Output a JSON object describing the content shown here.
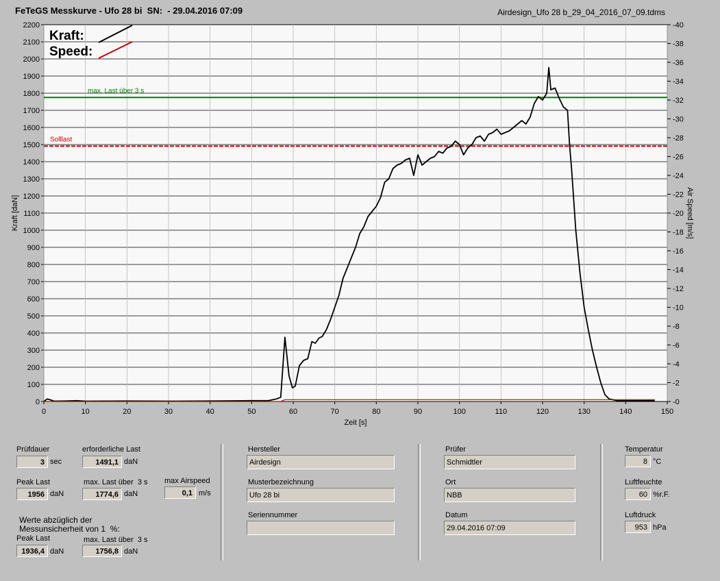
{
  "header": {
    "title": "FeTeGS Messkurve - Ufo 28 bi  SN:  - 29.04.2016 07:09",
    "filename": "Airdesign_Ufo 28 b_29_04_2016_07_09.tdms"
  },
  "chart_data": {
    "type": "line",
    "xlabel": "Zeit [s]",
    "ylabel": "Kraft [daN]",
    "y2label": "Air Speed [m/s]",
    "xlim": [
      0,
      150
    ],
    "ylim": [
      0,
      2200
    ],
    "y2lim": [
      0,
      40
    ],
    "x_ticks": [
      0,
      10,
      20,
      30,
      40,
      50,
      60,
      70,
      80,
      90,
      100,
      110,
      120,
      130,
      140,
      150
    ],
    "y_ticks": [
      0,
      100,
      200,
      300,
      400,
      500,
      600,
      700,
      800,
      900,
      1000,
      1100,
      1200,
      1300,
      1400,
      1500,
      1600,
      1700,
      1800,
      1900,
      2000,
      2100,
      2200
    ],
    "y2_ticks": [
      0,
      2,
      4,
      6,
      8,
      10,
      12,
      14,
      16,
      18,
      20,
      22,
      24,
      26,
      28,
      30,
      32,
      34,
      36,
      38,
      40
    ],
    "grid": true,
    "legend": {
      "placement": "top-left",
      "entries": [
        {
          "label": "Kraft:",
          "color": "#000000"
        },
        {
          "label": "Speed:",
          "color": "#cc0000"
        }
      ]
    },
    "reference_lines": [
      {
        "label": "max. Last über  3 s",
        "y": 1775,
        "color": "#008000"
      },
      {
        "label": "Solllast",
        "y": 1491,
        "color": "#cc0000"
      }
    ],
    "series": [
      {
        "name": "Kraft",
        "color": "#000000",
        "x": [
          0,
          0.8,
          1.5,
          2.5,
          5,
          8,
          10,
          20,
          30,
          40,
          50,
          54,
          56,
          57,
          58,
          59,
          59.8,
          60.5,
          61.5,
          62.5,
          63.5,
          64.5,
          65.3,
          66.2,
          67,
          68,
          69,
          70,
          71,
          72,
          73,
          74,
          75,
          76,
          77,
          78,
          79,
          80,
          81,
          82,
          83,
          84,
          85,
          86,
          87,
          88,
          89,
          90,
          91,
          92,
          93,
          94,
          95,
          96,
          97,
          98,
          99,
          100,
          101,
          102,
          103,
          104,
          105,
          106,
          107,
          108,
          109,
          110,
          111,
          112,
          113,
          114,
          115,
          116,
          117,
          118,
          119,
          120,
          121,
          121.5,
          122,
          123,
          124,
          125,
          126,
          126.5,
          127,
          128,
          129,
          130,
          131,
          132,
          133,
          134,
          135,
          136,
          138,
          147
        ],
        "y": [
          0,
          15,
          10,
          2,
          3,
          5,
          2,
          3,
          2,
          3,
          5,
          5,
          15,
          25,
          375,
          150,
          80,
          90,
          210,
          240,
          250,
          350,
          340,
          370,
          380,
          420,
          480,
          550,
          620,
          720,
          780,
          840,
          900,
          980,
          1020,
          1080,
          1110,
          1140,
          1190,
          1280,
          1300,
          1360,
          1380,
          1390,
          1410,
          1420,
          1320,
          1440,
          1380,
          1400,
          1420,
          1430,
          1460,
          1450,
          1480,
          1490,
          1520,
          1500,
          1440,
          1480,
          1500,
          1540,
          1550,
          1520,
          1560,
          1570,
          1590,
          1560,
          1570,
          1580,
          1600,
          1620,
          1640,
          1620,
          1660,
          1740,
          1780,
          1760,
          1800,
          1950,
          1820,
          1830,
          1770,
          1720,
          1700,
          1500,
          1350,
          1000,
          750,
          550,
          420,
          300,
          200,
          110,
          40,
          15,
          5,
          5
        ]
      },
      {
        "name": "Speed",
        "color": "#cc0000",
        "x": [
          0,
          57,
          58,
          147
        ],
        "y": [
          0,
          0,
          0.2,
          0.2
        ]
      }
    ]
  },
  "info": {
    "pruefdauer_label": "Prüfdauer",
    "pruefdauer_value": "3",
    "pruefdauer_unit": "sec",
    "erf_last_label": "erforderliche Last",
    "erf_last_value": "1491,1",
    "erf_last_unit": "daN",
    "peak_label": "Peak Last",
    "peak_value": "1956",
    "peak_unit": "daN",
    "max_last_label": "max. Last über  3 s",
    "max_last_value": "1774,6",
    "max_last_unit": "daN",
    "airspeed_label": "max Airspeed",
    "airspeed_value": "0,1",
    "airspeed_unit": "m/s",
    "werte_text": "Werte abzüglich der\nMessunsicherheit von 1  %:",
    "peak2_label": "Peak Last",
    "peak2_value": "1936,4",
    "peak2_unit": "daN",
    "max_last2_label": "max. Last über  3 s",
    "max_last2_value": "1756,8",
    "max_last2_unit": "daN"
  },
  "maker": {
    "hersteller_label": "Hersteller",
    "hersteller_value": "Airdesign",
    "muster_label": "Musterbezeichnung",
    "muster_value": "Ufo 28 bi",
    "serie_label": "Seriennummer",
    "serie_value": ""
  },
  "tester": {
    "pruefer_label": "Prüfer",
    "pruefer_value": "Schmidtler",
    "ort_label": "Ort",
    "ort_value": "NBB",
    "datum_label": "Datum",
    "datum_value": "29.04.2016 07:09"
  },
  "weather": {
    "temp_label": "Temperatur",
    "temp_value": "8",
    "temp_unit": "°C",
    "feuchte_label": "Luftfeuchte",
    "feuchte_value": "60",
    "feuchte_unit": "%r.F.",
    "druck_label": "Luftdruck",
    "druck_value": "953",
    "druck_unit": "hPa"
  }
}
